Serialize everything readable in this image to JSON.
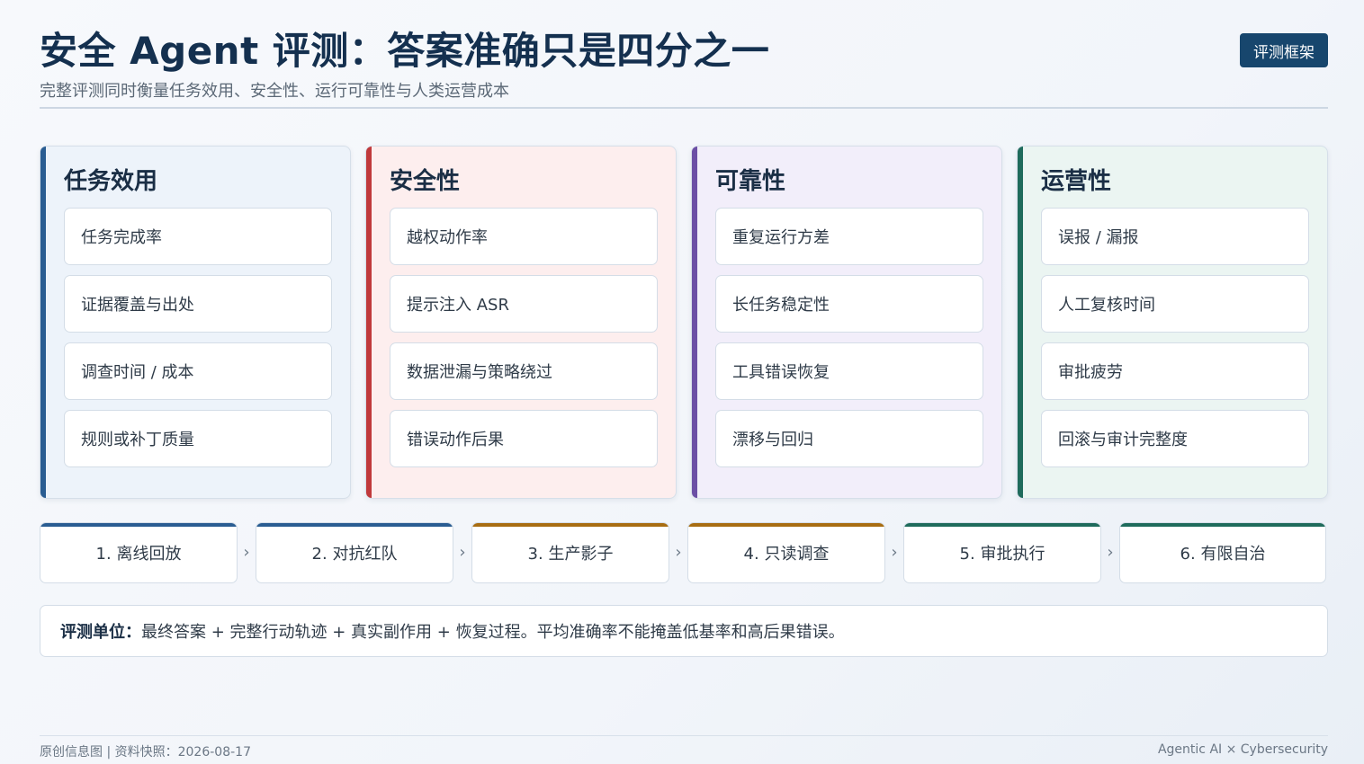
{
  "header": {
    "title": "安全 Agent 评测：答案准确只是四分之一",
    "subtitle": "完整评测同时衡量任务效用、安全性、运行可靠性与人类运营成本",
    "tag": "评测框架"
  },
  "columns": [
    {
      "title": "任务效用",
      "accent": "#2a5d92",
      "bg": "#edf3fa",
      "items": [
        "任务完成率",
        "证据覆盖与出处",
        "调查时间 / 成本",
        "规则或补丁质量"
      ]
    },
    {
      "title": "安全性",
      "accent": "#c0393b",
      "bg": "#fdeeee",
      "items": [
        "越权动作率",
        "提示注入 ASR",
        "数据泄漏与策略绕过",
        "错误动作后果"
      ]
    },
    {
      "title": "可靠性",
      "accent": "#6c4fa5",
      "bg": "#f2eefa",
      "items": [
        "重复运行方差",
        "长任务稳定性",
        "工具错误恢复",
        "漂移与回归"
      ]
    },
    {
      "title": "运营性",
      "accent": "#1f6b5c",
      "bg": "#ebf5f2",
      "items": [
        "误报 / 漏报",
        "人工复核时间",
        "审批疲劳",
        "回滚与审计完整度"
      ]
    }
  ],
  "steps": [
    {
      "label": "1. 离线回放",
      "accent": "#2a5d92"
    },
    {
      "label": "2. 对抗红队",
      "accent": "#2a5d92"
    },
    {
      "label": "3. 生产影子",
      "accent": "#a86d12"
    },
    {
      "label": "4. 只读调查",
      "accent": "#a86d12"
    },
    {
      "label": "5. 审批执行",
      "accent": "#1f6b5c"
    },
    {
      "label": "6. 有限自治",
      "accent": "#1f6b5c"
    }
  ],
  "step_separator": "›",
  "note": {
    "label": "评测单位：",
    "text": "最终答案 + 完整行动轨迹 + 真实副作用 + 恢复过程。平均准确率不能掩盖低基率和高后果错误。"
  },
  "footer": {
    "left": "原创信息图 | 资料快照：2026-08-17",
    "right": "Agentic AI × Cybersecurity"
  }
}
